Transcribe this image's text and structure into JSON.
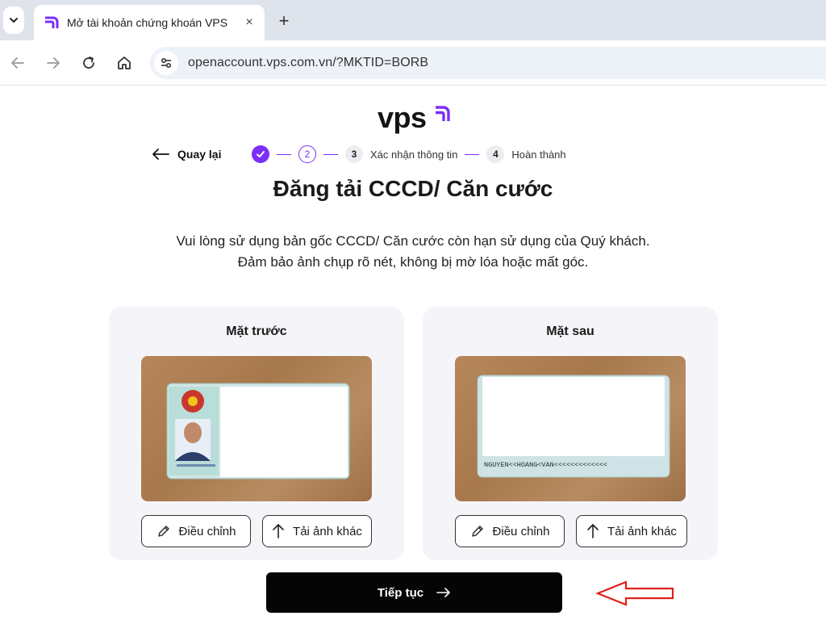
{
  "browser": {
    "tab_title": "Mở tài khoản chứng khoán VPS",
    "url": "openaccount.vps.com.vn/?MKTID=BORB",
    "new_tab_symbol": "+",
    "close_symbol": "×"
  },
  "page": {
    "logo_text": "vps",
    "back_label": "Quay lại",
    "steps": [
      {
        "number": "1",
        "state": "done",
        "label": ""
      },
      {
        "number": "2",
        "state": "active",
        "label": ""
      },
      {
        "number": "3",
        "state": "idle",
        "label": "Xác nhận thông tin"
      },
      {
        "number": "4",
        "state": "idle",
        "label": "Hoàn thành"
      }
    ],
    "title": "Đăng tải CCCD/ Căn cước",
    "description_line1": "Vui lòng sử dụng bản gốc CCCD/ Căn cước còn hạn sử dụng của Quý khách.",
    "description_line2": "Đảm bảo ảnh chụp rõ nét, không bị mờ lóa hoặc mất góc.",
    "front_card": {
      "title": "Mặt trước",
      "edit_label": "Điều chỉnh",
      "reupload_label": "Tải ảnh khác"
    },
    "back_card": {
      "title": "Mặt sau",
      "edit_label": "Điều chỉnh",
      "reupload_label": "Tải ảnh khác",
      "mrz_text": "NGUYEN<<HOANG<VAN<<<<<<<<<<<<<"
    },
    "continue_label": "Tiếp tục"
  },
  "colors": {
    "brand_purple": "#7b2ff7",
    "cta_background": "#050505",
    "card_background": "#f5f5f9",
    "annotation_red": "#e0201c"
  },
  "icons": [
    "chevron-down-icon",
    "vps-favicon-icon",
    "close-icon",
    "plus-icon",
    "back-arrow-icon",
    "forward-arrow-icon",
    "reload-icon",
    "home-icon",
    "site-settings-icon",
    "left-arrow-icon",
    "check-icon",
    "pencil-icon",
    "upload-arrow-icon",
    "right-arrow-icon"
  ]
}
